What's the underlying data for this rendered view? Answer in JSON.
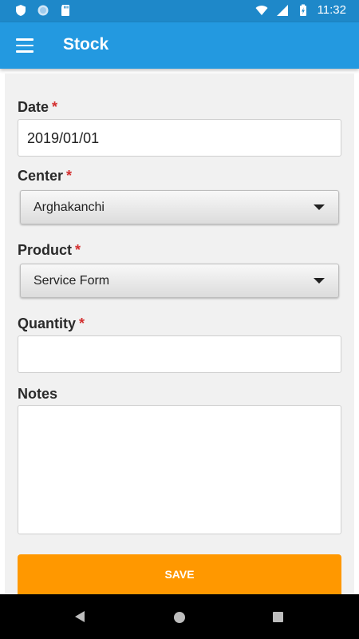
{
  "status_bar": {
    "time": "11:32",
    "icons": [
      "shield-icon",
      "circle-sync-icon",
      "sd-card-icon",
      "wifi-icon",
      "signal-icon",
      "battery-charging-icon"
    ]
  },
  "app_bar": {
    "title": "Stock",
    "menu_icon": "menu-icon"
  },
  "form": {
    "required_marker": "*",
    "date": {
      "label": "Date",
      "value": "2019/01/01"
    },
    "center": {
      "label": "Center",
      "value": "Arghakanchi"
    },
    "product": {
      "label": "Product",
      "value": "Service Form"
    },
    "quantity": {
      "label": "Quantity",
      "value": ""
    },
    "notes": {
      "label": "Notes",
      "value": ""
    },
    "save_label": "SAVE"
  },
  "nav_bar": {
    "icons": [
      "back-icon",
      "home-icon",
      "recents-icon"
    ]
  },
  "colors": {
    "status_bar": "#1e88c9",
    "app_bar": "#2399e0",
    "save_button": "#ff9800",
    "required": "#d32f2f"
  }
}
